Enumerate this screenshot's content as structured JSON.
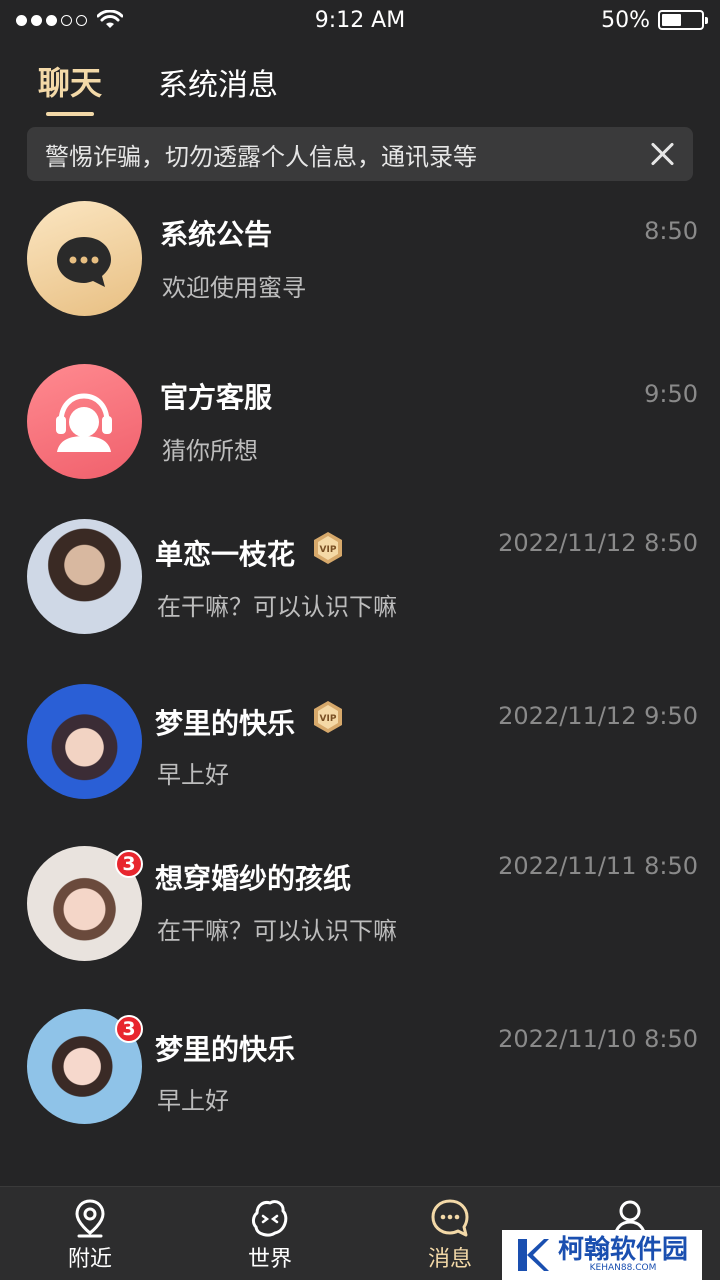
{
  "status_bar": {
    "time": "9:12 AM",
    "battery": "50%",
    "battery_level": 0.5,
    "signal_dots_filled": 3,
    "signal_dots_total": 5
  },
  "tabs": [
    {
      "label": "聊天",
      "active": true
    },
    {
      "label": "系统消息",
      "active": false
    }
  ],
  "notice": {
    "text": "警惕诈骗，切勿透露个人信息，通讯录等"
  },
  "chats": [
    {
      "name": "系统公告",
      "preview": "欢迎使用蜜寻",
      "time": "8:50",
      "vip": false,
      "unread": null,
      "avatar": "system-announcement-icon"
    },
    {
      "name": "官方客服",
      "preview": "猜你所想",
      "time": "9:50",
      "vip": false,
      "unread": null,
      "avatar": "customer-service-icon"
    },
    {
      "name": "单恋一枝花",
      "preview": "在干嘛？可以认识下嘛",
      "time": "2022/11/12 8:50",
      "vip": true,
      "unread": null,
      "avatar": "user-photo"
    },
    {
      "name": "梦里的快乐",
      "preview": "早上好",
      "time": "2022/11/12 9:50",
      "vip": true,
      "unread": null,
      "avatar": "user-photo"
    },
    {
      "name": "想穿婚纱的孩纸",
      "preview": "在干嘛？可以认识下嘛",
      "time": "2022/11/11 8:50",
      "vip": false,
      "unread": "3",
      "avatar": "user-photo"
    },
    {
      "name": "梦里的快乐",
      "preview": "早上好",
      "time": "2022/11/10 8:50",
      "vip": false,
      "unread": "3",
      "avatar": "user-photo"
    }
  ],
  "vip_label": "VIP",
  "tabbar": [
    {
      "label": "附近",
      "icon": "location-icon",
      "active": false
    },
    {
      "label": "世界",
      "icon": "world-face-icon",
      "active": false
    },
    {
      "label": "消息",
      "icon": "message-icon",
      "active": true
    },
    {
      "label": "",
      "icon": "profile-icon",
      "active": false
    }
  ],
  "watermark": {
    "text": "柯翰软件园",
    "sub": "KEHAN88.COM"
  },
  "colors": {
    "background": "#252526",
    "accent_gold": "#f3d9a8",
    "badge_red": "#e8262e",
    "service_pink": "#f06e7a"
  }
}
